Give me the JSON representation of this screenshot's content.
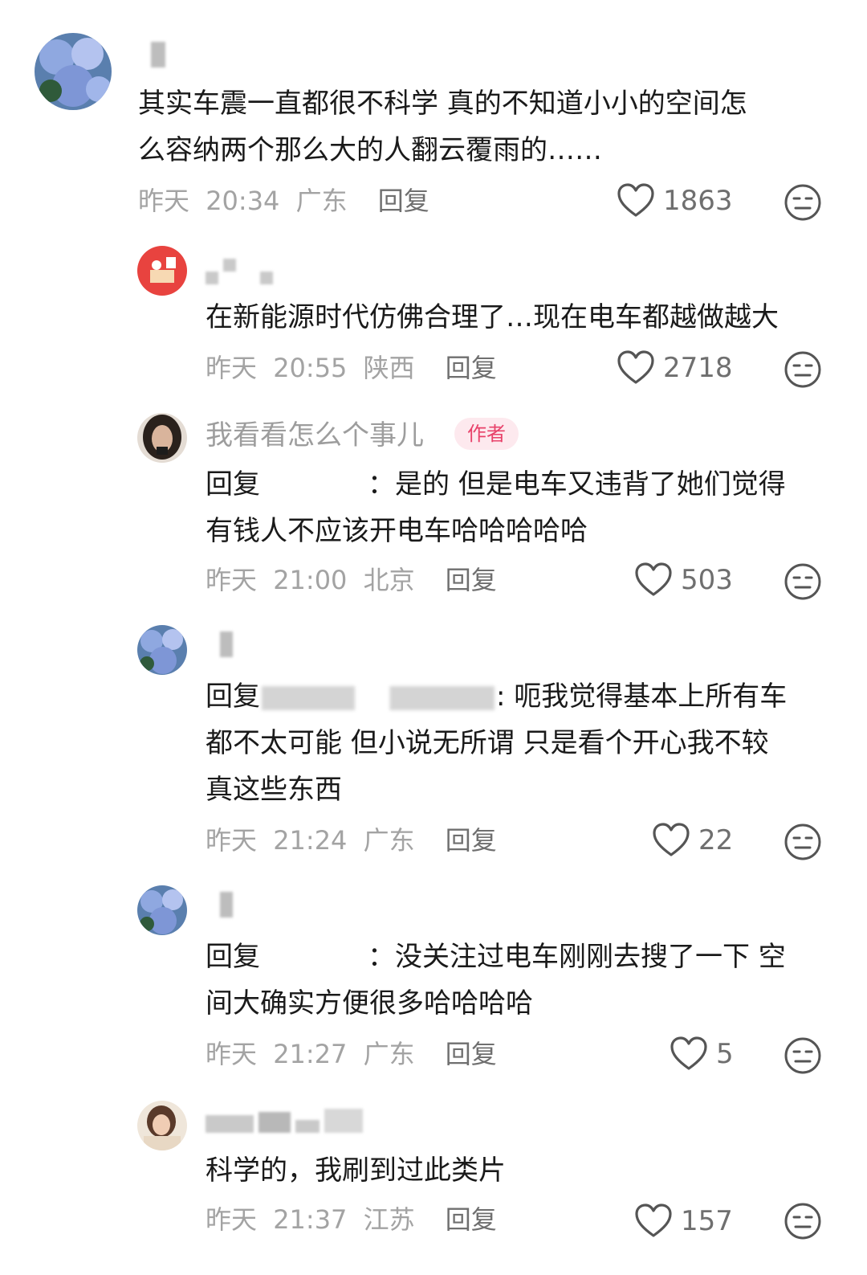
{
  "comments": [
    {
      "text_lines": [
        "其实车震一直都很不科学 真的不知道小小的空间怎",
        "么容纳两个那么大的人翻云覆雨的……"
      ],
      "day": "昨天",
      "time": "20:34",
      "location": "广东",
      "reply_label": "回复",
      "likes": "1863"
    },
    {
      "text_lines": [
        "在新能源时代仿佛合理了…现在电车都越做越大"
      ],
      "day": "昨天",
      "time": "20:55",
      "location": "陕西",
      "reply_label": "回复",
      "likes": "2718"
    },
    {
      "author": "我看看怎么个事儿",
      "badge": "作者",
      "reply_prefix": "回复",
      "text_line1": "：是的 但是电车又违背了她们觉得",
      "text_line2": "有钱人不应该开电车哈哈哈哈哈",
      "day": "昨天",
      "time": "21:00",
      "location": "北京",
      "reply_label": "回复",
      "likes": "503"
    },
    {
      "reply_prefix": "回复",
      "text_line1": ": 呃我觉得基本上所有车",
      "text_line2": "都不太可能 但小说无所谓 只是看个开心我不较",
      "text_line3": "真这些东西",
      "day": "昨天",
      "time": "21:24",
      "location": "广东",
      "reply_label": "回复",
      "likes": "22"
    },
    {
      "reply_prefix": "回复",
      "text_line1": "：没关注过电车刚刚去搜了一下 空",
      "text_line2": "间大确实方便很多哈哈哈哈",
      "day": "昨天",
      "time": "21:27",
      "location": "广东",
      "reply_label": "回复",
      "likes": "5"
    },
    {
      "text_lines": [
        "科学的，我刷到过此类片"
      ],
      "day": "昨天",
      "time": "21:37",
      "location": "江苏",
      "reply_label": "回复",
      "likes": "157"
    }
  ],
  "icons": {
    "like": "heart-outline-icon",
    "dislike": "neutral-face-icon"
  },
  "colors": {
    "meta_gray": "#a3a3a3",
    "author_badge": "#e8426a",
    "author_badge_bg": "#fde9ee"
  }
}
